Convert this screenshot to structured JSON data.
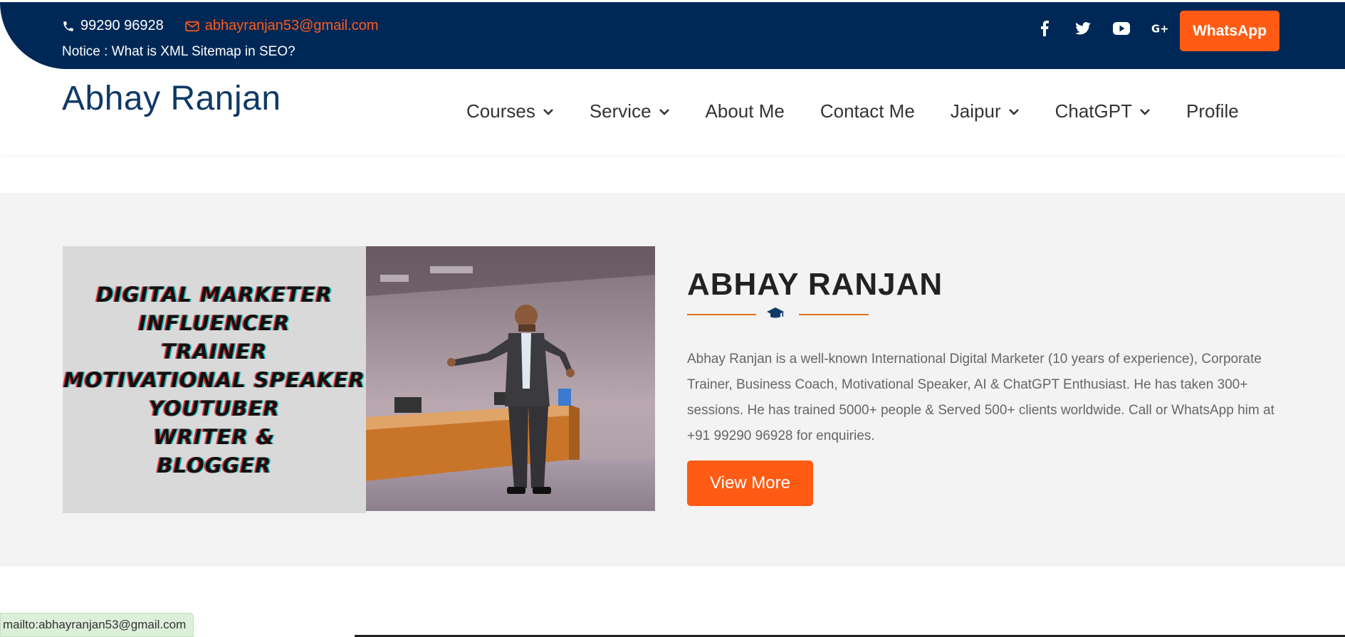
{
  "topbar": {
    "phone": "99290 96928",
    "email": "abhayranjan53@gmail.com",
    "notice": "Notice : What is XML Sitemap in SEO?",
    "socials": [
      "facebook-icon",
      "twitter-icon",
      "youtube-icon",
      "google-plus-icon"
    ],
    "whatsapp_label": "WhatsApp"
  },
  "header": {
    "logo": "Abhay Ranjan",
    "nav": {
      "courses": "Courses",
      "service": "Service",
      "about": "About Me",
      "contact": "Contact Me",
      "jaipur": "Jaipur",
      "chatgpt": "ChatGPT",
      "profile": "Profile"
    }
  },
  "hero": {
    "image_lines": {
      "l1": "DIGITAL MARKETER",
      "l2": "INFLUENCER",
      "l3": "TRAINER",
      "l4": "MOTIVATIONAL SPEAKER",
      "l5": "YOUTUBER",
      "l6": "WRITER &",
      "l7": "BLOGGER"
    },
    "title": "ABHAY RANJAN",
    "description": "Abhay Ranjan is a well-known International Digital Marketer (10 years of experience), Corporate Trainer, Business Coach, Motivational Speaker, AI & ChatGPT Enthusiast. He has taken 300+ sessions. He has trained 5000+ people & Served 500+ clients worldwide. Call or WhatsApp him at +91 99290 96928 for enquiries.",
    "button": "View More"
  },
  "statusbar": {
    "text": "mailto:abhayranjan53@gmail.com"
  },
  "colors": {
    "navy": "#002856",
    "orange": "#ff5b14",
    "divider": "#d8731f"
  }
}
